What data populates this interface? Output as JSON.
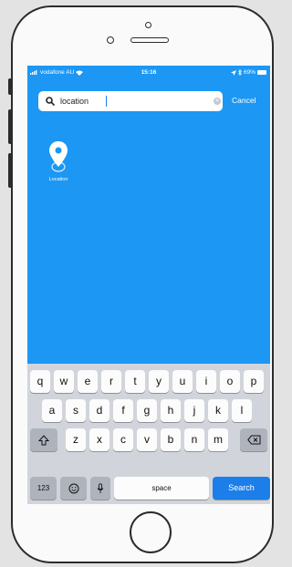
{
  "status_bar": {
    "carrier": "vodafone AU",
    "time": "15:16",
    "battery": "69%"
  },
  "search": {
    "value": "location",
    "cancel_label": "Cancel"
  },
  "result": {
    "label": "Location",
    "icon": "map-pin-icon"
  },
  "keyboard": {
    "row1": [
      "q",
      "w",
      "e",
      "r",
      "t",
      "y",
      "u",
      "i",
      "o",
      "p"
    ],
    "row2": [
      "a",
      "s",
      "d",
      "f",
      "g",
      "h",
      "j",
      "k",
      "l"
    ],
    "row3": [
      "z",
      "x",
      "c",
      "v",
      "b",
      "n",
      "m"
    ],
    "numbers_label": "123",
    "space_label": "space",
    "search_label": "Search"
  },
  "colors": {
    "screen_bg": "#1c97f4",
    "keyboard_bg": "#d1d5db",
    "accent": "#1c7ee8"
  }
}
